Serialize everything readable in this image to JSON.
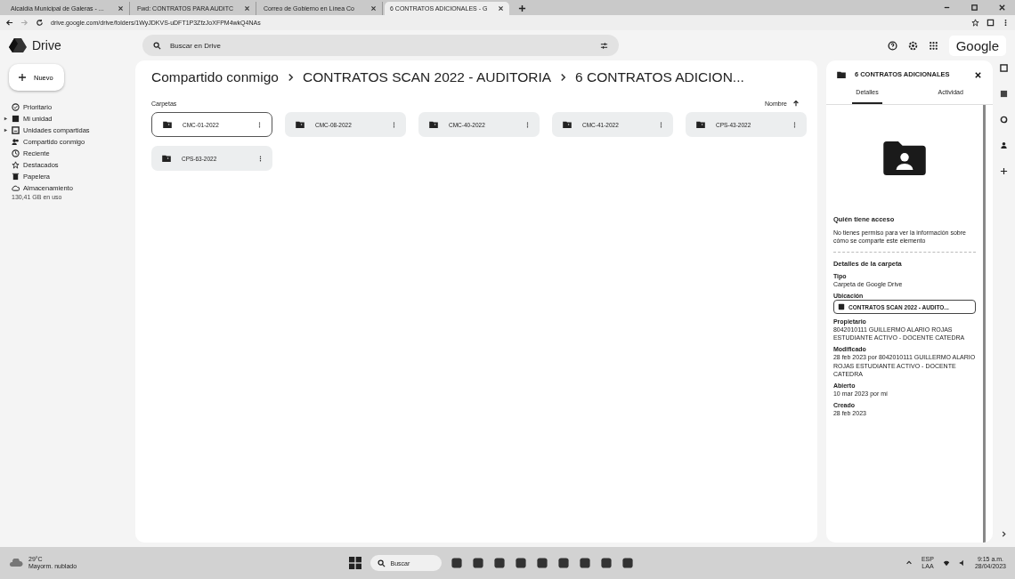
{
  "browser": {
    "tabs": [
      {
        "title": "Alcaldía Municipal de Galeras - ...",
        "selected": false
      },
      {
        "title": "Fwd: CONTRATOS PARA AUDITC",
        "selected": false
      },
      {
        "title": "Correo de Gobierno en Línea Co",
        "selected": false
      },
      {
        "title": "6 CONTRATOS ADICIONALES - G",
        "selected": true
      }
    ],
    "url": "drive.google.com/drive/folders/1WyJDKVS-uDFT1P3ZfzJoXFPM4wkQ4NAs"
  },
  "header": {
    "app_name": "Drive",
    "search": {
      "placeholder": "Buscar en Drive"
    },
    "account": "Google"
  },
  "sidebar": {
    "new_button": "Nuevo",
    "items": [
      {
        "label": "Prioritario",
        "expandable": false
      },
      {
        "label": "Mi unidad",
        "expandable": true
      },
      {
        "label": "Unidades compartidas",
        "expandable": true
      },
      {
        "label": "Compartido conmigo",
        "expandable": false
      },
      {
        "label": "Reciente",
        "expandable": false
      },
      {
        "label": "Destacados",
        "expandable": false
      },
      {
        "label": "Papelera",
        "expandable": false
      },
      {
        "label": "Almacenamiento",
        "expandable": false
      }
    ],
    "storage": "130,41 GB en uso"
  },
  "breadcrumbs": [
    "Compartido conmigo",
    "CONTRATOS SCAN 2022 - AUDITORIA",
    "6 CONTRATOS ADICION..."
  ],
  "section_title": "Carpetas",
  "sort": {
    "label": "Nombre"
  },
  "folders": [
    {
      "name": "CMC-01-2022",
      "selected": true
    },
    {
      "name": "CMC-08-2022",
      "selected": false
    },
    {
      "name": "CMC-40-2022",
      "selected": false
    },
    {
      "name": "CMC-41-2022",
      "selected": false
    },
    {
      "name": "CPS-43-2022",
      "selected": false
    },
    {
      "name": "CPS-63-2022",
      "selected": false
    }
  ],
  "details": {
    "title": "6 CONTRATOS ADICIONALES",
    "tabs": [
      {
        "label": "Detalles",
        "selected": true
      },
      {
        "label": "Actividad",
        "selected": false
      }
    ],
    "access_title": "Quién tiene acceso",
    "access_text": "No tienes permiso para ver la información sobre cómo se comparte este elemento",
    "section_title": "Detalles de la carpeta",
    "fields": [
      {
        "label": "Tipo",
        "value": "Carpeta de Google Drive",
        "kind": "text"
      },
      {
        "label": "Ubicación",
        "value": "CONTRATOS SCAN 2022 - AUDITO...",
        "kind": "chip"
      },
      {
        "label": "Propietario",
        "value": "8042010111 GUILLERMO ALARIO ROJAS ESTUDIANTE ACTIVO - DOCENTE CATEDRA",
        "kind": "text"
      },
      {
        "label": "Modificado",
        "value": "28 feb 2023 por 8042010111 GUILLERMO ALARIO ROJAS ESTUDIANTE ACTIVO - DOCENTE CATEDRA",
        "kind": "text"
      },
      {
        "label": "Abierto",
        "value": "10 mar 2023 por mí",
        "kind": "text"
      },
      {
        "label": "Creado",
        "value": "28 feb 2023",
        "kind": "text"
      }
    ]
  },
  "taskbar": {
    "weather_temp": "29°C",
    "weather_text": "Mayorm. nublado",
    "search": "Buscar",
    "language": "ESP",
    "layout": "LAA",
    "time": "9:15 a.m.",
    "date": "28/04/2023"
  }
}
